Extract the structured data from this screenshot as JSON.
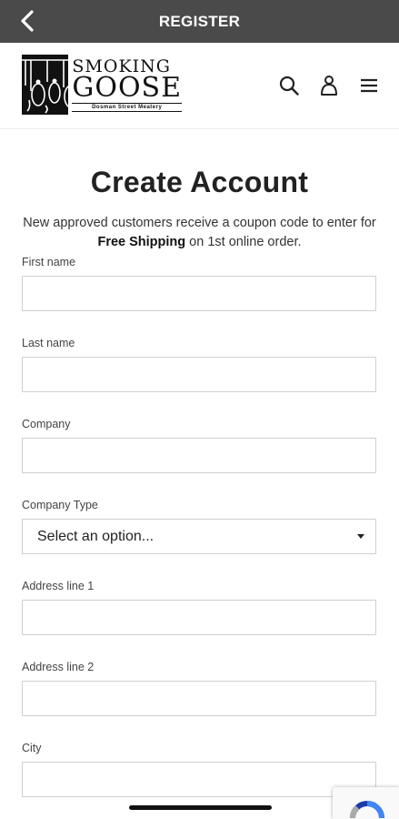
{
  "topbar": {
    "title": "REGISTER"
  },
  "logo": {
    "line1": "SMOKING",
    "line2": "GOOSE",
    "line3": "Dosman Street Meatery"
  },
  "page": {
    "title": "Create Account",
    "intro_before": "New approved customers receive a coupon code to enter for ",
    "intro_bold": "Free Shipping",
    "intro_after": " on 1st online order."
  },
  "form": {
    "first_name_label": "First name",
    "last_name_label": "Last name",
    "company_label": "Company",
    "company_type_label": "Company Type",
    "company_type_value": "Select an option...",
    "address1_label": "Address line 1",
    "address2_label": "Address line 2",
    "city_label": "City"
  },
  "icons": [
    "back-arrow-icon",
    "search-icon",
    "account-icon",
    "menu-icon",
    "recaptcha-icon"
  ],
  "colors": {
    "topbar": "#4a4a4a",
    "text": "#222222",
    "border": "#cfcfcf"
  }
}
